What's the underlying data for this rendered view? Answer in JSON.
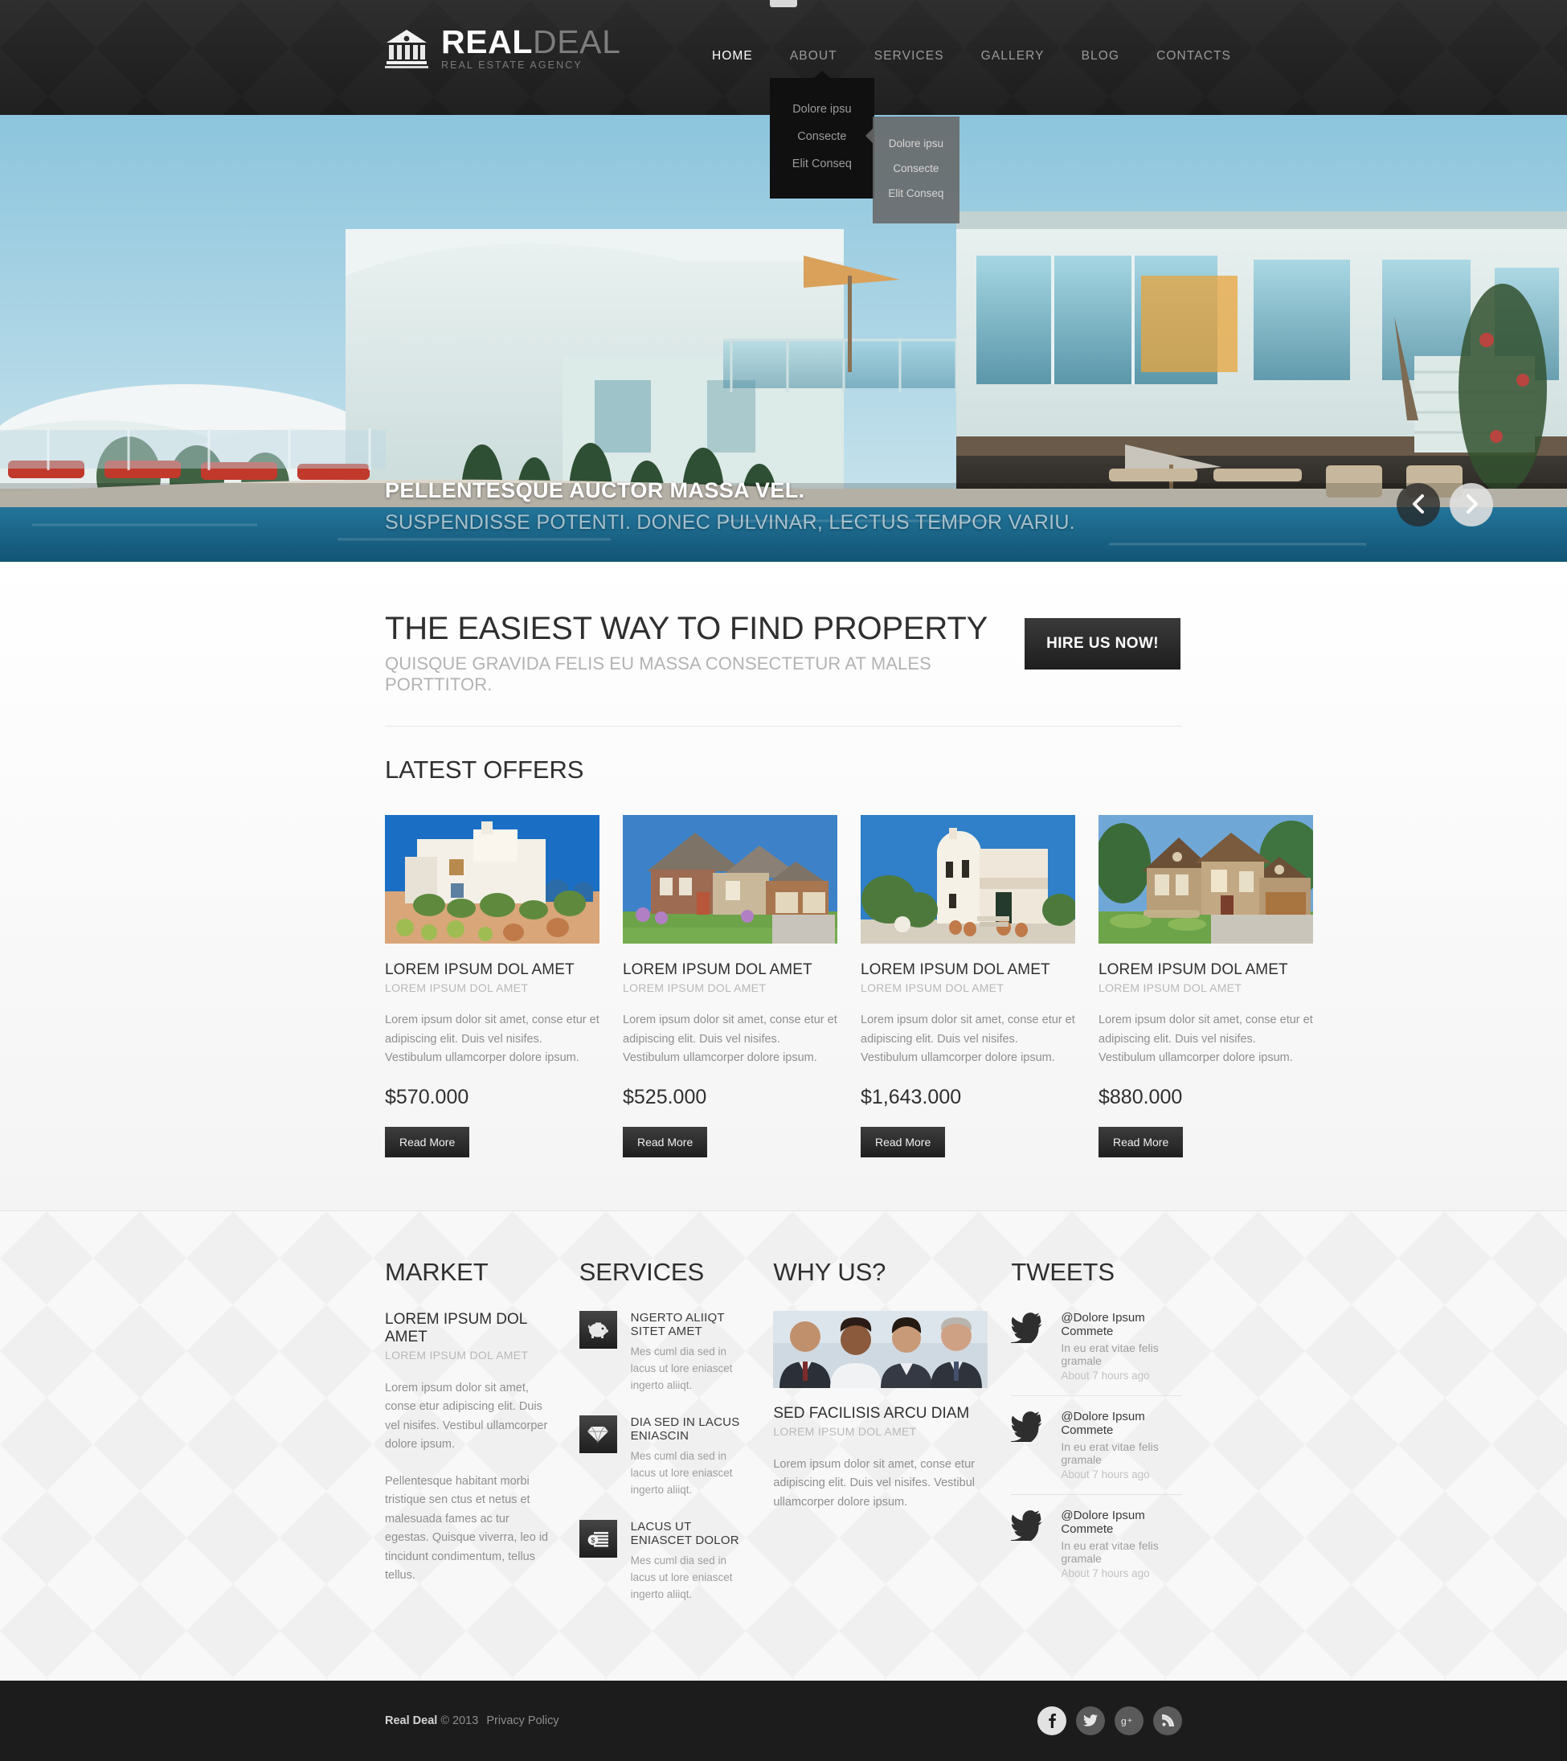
{
  "brand": {
    "logo_icon": "bank-building-icon",
    "name_strong": "REAL",
    "name_light": "DEAL",
    "tagline": "REAL ESTATE AGENCY"
  },
  "nav": {
    "items": [
      {
        "label": "HOME",
        "active": true
      },
      {
        "label": "ABOUT",
        "active": false
      },
      {
        "label": "SERVICES",
        "active": false
      },
      {
        "label": "GALLERY",
        "active": false
      },
      {
        "label": "BLOG",
        "active": false
      },
      {
        "label": "CONTACTS",
        "active": false
      }
    ],
    "dropdown": [
      "Dolore ipsu",
      "Consecte",
      "Elit Conseq"
    ],
    "subdropdown": [
      "Dolore ipsu",
      "Consecte",
      "Elit Conseq"
    ]
  },
  "slider": {
    "caption_title": "PELLENTESQUE AUCTOR MASSA VEL.",
    "caption_sub": "SUSPENDISSE POTENTI. DONEC PULVINAR, LECTUS TEMPOR VARIU.",
    "prev_icon": "chevron-left-icon",
    "next_icon": "chevron-right-icon"
  },
  "intro": {
    "headline": "THE EASIEST WAY TO FIND PROPERTY",
    "subheadline": "QUISQUE GRAVIDA FELIS EU MASSA CONSECTETUR AT MALES PORTTITOR.",
    "cta_label": "HIRE US NOW!"
  },
  "offers": {
    "title": "LATEST OFFERS",
    "read_more_label": "Read More",
    "items": [
      {
        "title": "LOREM IPSUM DOL AMET",
        "subtitle": "LOREM IPSUM DOL AMET",
        "text": "Lorem ipsum dolor sit amet, conse etur et adipiscing elit. Duis vel nisifes. Vestibulum ullamcorper dolore ipsum.",
        "price": "$570.000",
        "image": "white-mediterranean-villa"
      },
      {
        "title": "LOREM IPSUM DOL AMET",
        "subtitle": "LOREM IPSUM DOL AMET",
        "text": "Lorem ipsum dolor sit amet, conse etur et adipiscing elit. Duis vel nisifes. Vestibulum ullamcorper dolore ipsum.",
        "price": "$525.000",
        "image": "brick-suburban-house"
      },
      {
        "title": "LOREM IPSUM DOL AMET",
        "subtitle": "LOREM IPSUM DOL AMET",
        "text": "Lorem ipsum dolor sit amet, conse etur et adipiscing elit. Duis vel nisifes. Vestibulum ullamcorper dolore ipsum.",
        "price": "$1,643.000",
        "image": "white-tower-house"
      },
      {
        "title": "LOREM IPSUM DOL AMET",
        "subtitle": "LOREM IPSUM DOL AMET",
        "text": "Lorem ipsum dolor sit amet, conse etur et adipiscing elit. Duis vel nisifes. Vestibulum ullamcorper dolore ipsum.",
        "price": "$880.000",
        "image": "stone-gabled-house"
      }
    ]
  },
  "market": {
    "title": "MARKET",
    "item_title": "LOREM IPSUM DOL AMET",
    "item_subtitle": "LOREM IPSUM DOL AMET",
    "para1": "Lorem ipsum dolor sit amet, conse etur adipiscing elit. Duis vel nisifes. Vestibul ullamcorper dolore ipsum.",
    "para2": "Pellentesque habitant morbi tristique sen ctus et netus et malesuada fames ac tur egestas. Quisque viverra, leo id tincidunt condimentum, tellus tellus."
  },
  "services": {
    "title": "SERVICES",
    "items": [
      {
        "icon": "piggy-bank-icon",
        "title": "NGERTO ALIIQT SITET AMET",
        "text": "Mes cuml dia sed in lacus ut lore eniascet ingerto aliiqt."
      },
      {
        "icon": "diamond-icon",
        "title": "DIA SED IN LACUS ENIASCIN",
        "text": "Mes cuml dia sed in lacus ut lore eniascet ingerto aliiqt."
      },
      {
        "icon": "money-stack-icon",
        "title": "LACUS UT ENIASCET DOLOR",
        "text": "Mes cuml dia sed in lacus ut lore eniascet ingerto aliiqt."
      }
    ]
  },
  "why_us": {
    "title": "WHY US?",
    "image": "business-team-photo",
    "item_title": "SED FACILISIS ARCU DIAM",
    "item_subtitle": "LOREM IPSUM DOL AMET",
    "text": "Lorem ipsum dolor sit amet, conse etur adipiscing elit. Duis vel nisifes. Vestibul ullamcorper dolore ipsum."
  },
  "tweets": {
    "title": "TWEETS",
    "icon": "twitter-bird-icon",
    "items": [
      {
        "handle": "@Dolore Ipsum Commete",
        "text": "In eu erat vitae felis gramale",
        "time": "About 7 hours ago"
      },
      {
        "handle": "@Dolore Ipsum Commete",
        "text": "In eu erat vitae felis gramale",
        "time": "About 7 hours ago"
      },
      {
        "handle": "@Dolore Ipsum Commete",
        "text": "In eu erat vitae felis gramale",
        "time": "About 7 hours ago"
      }
    ]
  },
  "footer": {
    "brand": "Real Deal",
    "copyright": "© 2013",
    "privacy_label": "Privacy Policy",
    "socials": [
      {
        "name": "facebook-icon",
        "glyph": "f",
        "light": true
      },
      {
        "name": "twitter-icon",
        "glyph": "t",
        "light": false
      },
      {
        "name": "google-plus-icon",
        "glyph": "g+",
        "light": false
      },
      {
        "name": "rss-icon",
        "glyph": "rss",
        "light": false
      }
    ]
  },
  "colors": {
    "header_bg": "#232323",
    "dark_btn": "#1e1e1e",
    "text_dark": "#2f2f2f",
    "text_muted": "#8f8f8f"
  }
}
